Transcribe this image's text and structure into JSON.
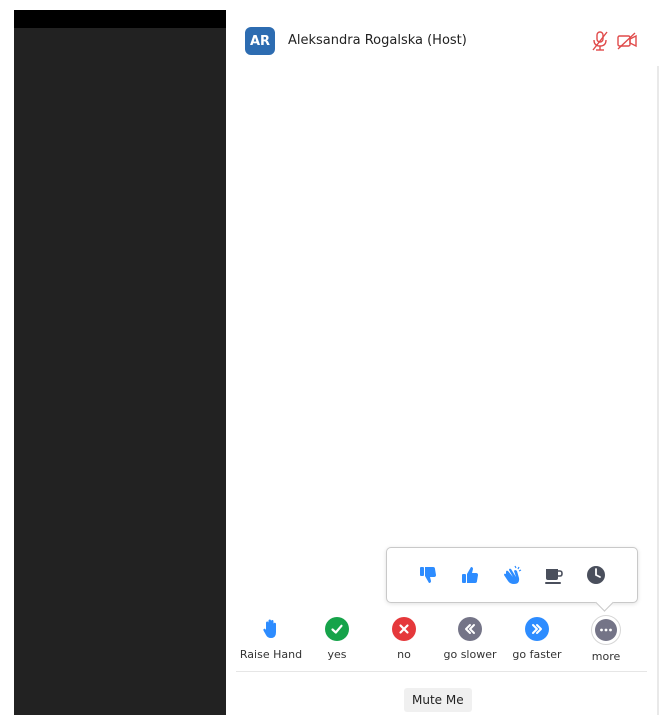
{
  "participant": {
    "initials": "AR",
    "name": "Aleksandra Rogalska (Host)",
    "avatar_color": "#2d6cb1",
    "status_icons": [
      "mic-muted-icon",
      "video-off-icon"
    ],
    "status_color": "#e04a4a"
  },
  "reactions_popup": {
    "icons": [
      "thumbs-down-icon",
      "thumbs-up-icon",
      "clap-icon",
      "coffee-icon",
      "clock-icon"
    ],
    "accent_color": "#2d8cff",
    "neutral_color": "#4a4f5c"
  },
  "feedback": {
    "items": [
      {
        "label": "Raise Hand",
        "icon": "raise-hand-icon",
        "color": "#2d8cff"
      },
      {
        "label": "yes",
        "icon": "check-icon",
        "color": "#16a34a"
      },
      {
        "label": "no",
        "icon": "x-icon",
        "color": "#e5383b"
      },
      {
        "label": "go slower",
        "icon": "go-slower-icon",
        "color": "#747487"
      },
      {
        "label": "go faster",
        "icon": "go-faster-icon",
        "color": "#2d8cff"
      },
      {
        "label": "more",
        "icon": "more-icon",
        "color": "#747487"
      }
    ]
  },
  "mute_button": {
    "label": "Mute Me"
  }
}
